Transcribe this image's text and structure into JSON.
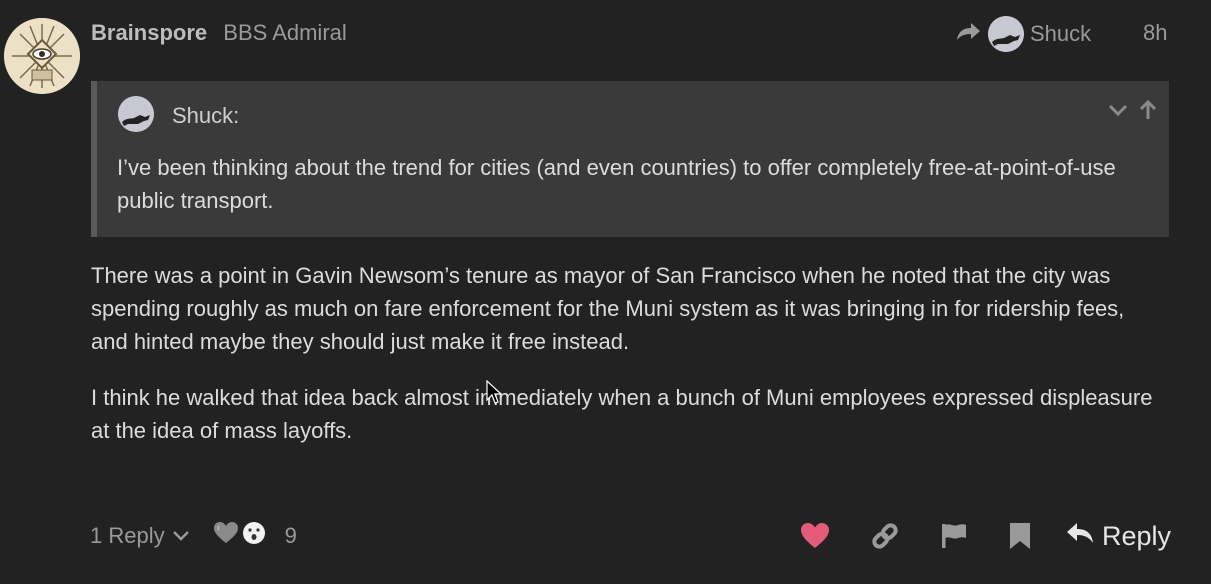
{
  "post": {
    "username": "Brainspore",
    "user_title": "BBS Admiral",
    "reply_to_user": "Shuck",
    "date": "8h",
    "quote": {
      "user": "Shuck:",
      "text": "I’ve been thinking about the trend for cities (and even countries) to offer completely free-at-point-of-use public transport."
    },
    "paragraphs": [
      "There was a point in Gavin Newsom’s tenure as mayor of San Francisco when he noted that the city was spending roughly as much on fare enforcement for the Muni system as it was bringing in for ridership fees, and hinted maybe they should just make it free instead.",
      "I think he walked that idea back almost immediately when a bunch of Muni employees expressed displeasure at the idea of mass layoffs."
    ]
  },
  "footer": {
    "replies_label": "1 Reply",
    "reaction_count": "9",
    "reply_label": "Reply"
  },
  "colors": {
    "background": "#222222",
    "quote_bg": "#3a3a3a",
    "heart": "#e45c7a",
    "muted": "#9a9a9a"
  }
}
